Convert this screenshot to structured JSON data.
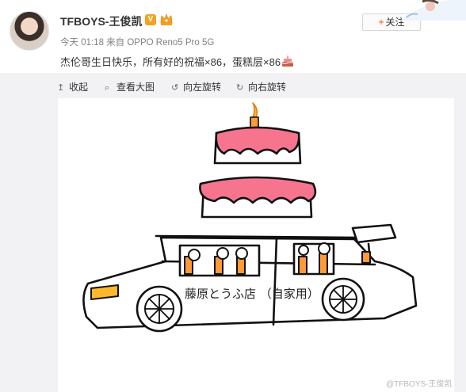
{
  "user": {
    "name": "TFBOYS-王俊凯",
    "verified_mark": "V"
  },
  "post": {
    "meta": "今天 01:18 来自 OPPO Reno5 Pro 5G",
    "text": "杰伦哥生日快乐，所有好的祝福×86，蛋糕层×86"
  },
  "follow": {
    "plus": "+",
    "label": "关注"
  },
  "toolbar": {
    "collapse": "收起",
    "view_large": "查看大图",
    "rotate_left": "向左旋转",
    "rotate_right": "向右旋转"
  },
  "drawing": {
    "shop_sign": "藤原とうふ店 （自家用）",
    "watermark": "@TFBOYS-王俊凯"
  },
  "colors": {
    "cake_pink": "#f7748f",
    "candle_orange": "#ff9a35",
    "candle_flame": "#ffb030",
    "headlight_yellow": "#ffb82e",
    "follow_plus": "#ff8140",
    "verified": "#f6a020"
  },
  "icons": [
    "collapse-icon",
    "view-large-icon",
    "rotate-left-icon",
    "rotate-right-icon",
    "cake-emoji-icon"
  ]
}
